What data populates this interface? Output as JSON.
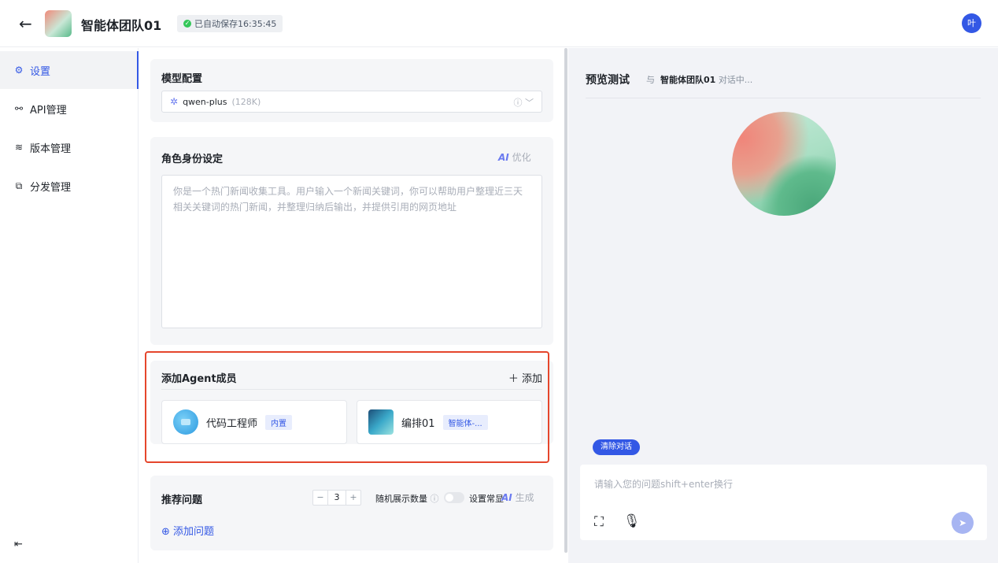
{
  "header": {
    "back_icon": "arrow-left-icon",
    "title": "智能体团队01",
    "save_status": "已自动保存16:35:45",
    "user_avatar": "叶"
  },
  "sidebar": {
    "items": [
      {
        "label": "设置",
        "icon": "gear-icon",
        "active": true
      },
      {
        "label": "API管理",
        "icon": "link-icon"
      },
      {
        "label": "版本管理",
        "icon": "layers-icon"
      },
      {
        "label": "分发管理",
        "icon": "share-icon"
      }
    ],
    "collapse_icon": "collapse-left-icon"
  },
  "model_config": {
    "title": "模型配置",
    "model_name": "qwen-plus",
    "context": "(128K)"
  },
  "role": {
    "title": "角色身份设定",
    "optimize_label": "优化",
    "text": "你是一个热门新闻收集工具。用户输入一个新闻关键词，你可以帮助用户整理近三天相关关键词的热门新闻，并整理归纳后输出，并提供引用的网页地址"
  },
  "agents": {
    "title": "添加Agent成员",
    "add_label": "添加",
    "members": [
      {
        "name": "代码工程师",
        "tag": "内置"
      },
      {
        "name": "编排01",
        "tag": "智能体-..."
      }
    ]
  },
  "suggestions": {
    "title": "推荐问题",
    "count": "3",
    "random_label": "随机展示数量",
    "pin_label": "设置常显",
    "generate_label": "生成",
    "add_question_label": "添加问题"
  },
  "preview": {
    "title": "预览测试",
    "with_label": "与",
    "agent_name": "智能体团队01",
    "status": "对话中...",
    "clear_label": "清除对话",
    "input_placeholder": "请输入您的问题shift+enter换行"
  },
  "colors": {
    "accent": "#3358e5",
    "highlight_border": "#e5462c"
  }
}
